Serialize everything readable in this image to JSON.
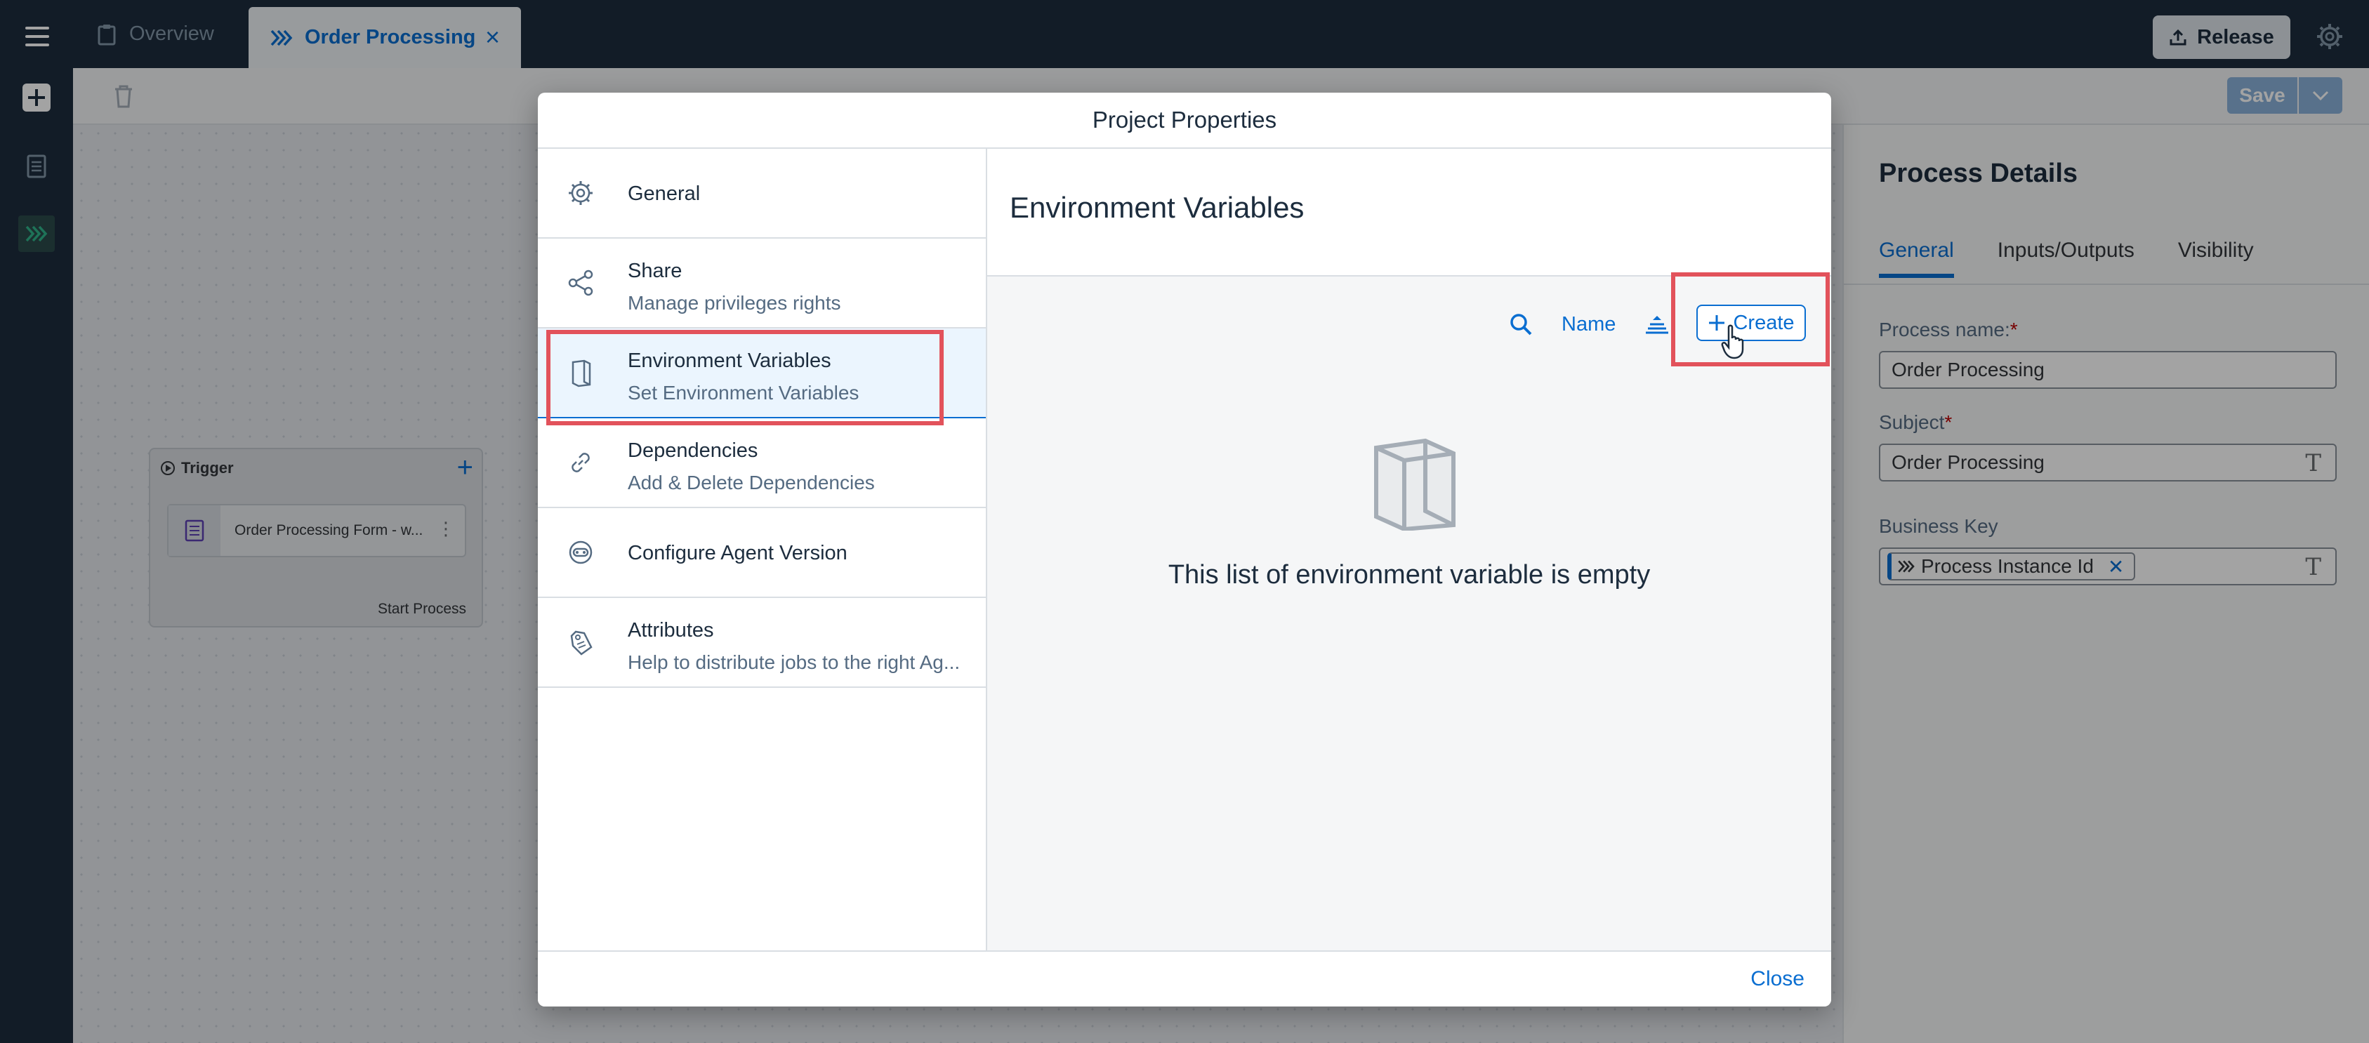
{
  "shell": {
    "tabs": [
      {
        "label": "Overview",
        "icon": "clipboard-icon"
      },
      {
        "label": "Order Processing",
        "icon": "process-chevrons-icon"
      }
    ],
    "release_label": "Release"
  },
  "toolbar": {
    "save_label": "Save"
  },
  "canvas": {
    "trigger": {
      "title": "Trigger",
      "form_label": "Order Processing Form - w...",
      "start_label": "Start Process"
    }
  },
  "details": {
    "title": "Process Details",
    "tabs": [
      "General",
      "Inputs/Outputs",
      "Visibility"
    ],
    "process_name_label": "Process name:",
    "process_name_value": "Order Processing",
    "subject_label": "Subject",
    "subject_value": "Order Processing",
    "business_key_label": "Business Key",
    "business_key_token": "Process Instance Id",
    "required_marker": "*"
  },
  "dialog": {
    "title": "Project Properties",
    "nav": [
      {
        "title": "General",
        "subtitle": "",
        "icon": "gear-icon"
      },
      {
        "title": "Share",
        "subtitle": "Manage privileges rights",
        "icon": "share-icon"
      },
      {
        "title": "Environment Variables",
        "subtitle": "Set Environment Variables",
        "icon": "document-icon"
      },
      {
        "title": "Dependencies",
        "subtitle": "Add & Delete Dependencies",
        "icon": "link-icon"
      },
      {
        "title": "Configure Agent Version",
        "subtitle": "",
        "icon": "robot-icon"
      },
      {
        "title": "Attributes",
        "subtitle": "Help to distribute jobs to the right Ag...",
        "icon": "tag-icon"
      }
    ],
    "content": {
      "title": "Environment Variables",
      "sort_label": "Name",
      "create_label": "Create",
      "empty_text": "This list of environment variable is empty"
    },
    "close_label": "Close"
  },
  "colors": {
    "shell": "#1d2d3e",
    "accent": "#0a6ed1",
    "highlight": "#e2525b",
    "required": "#bb0000"
  }
}
